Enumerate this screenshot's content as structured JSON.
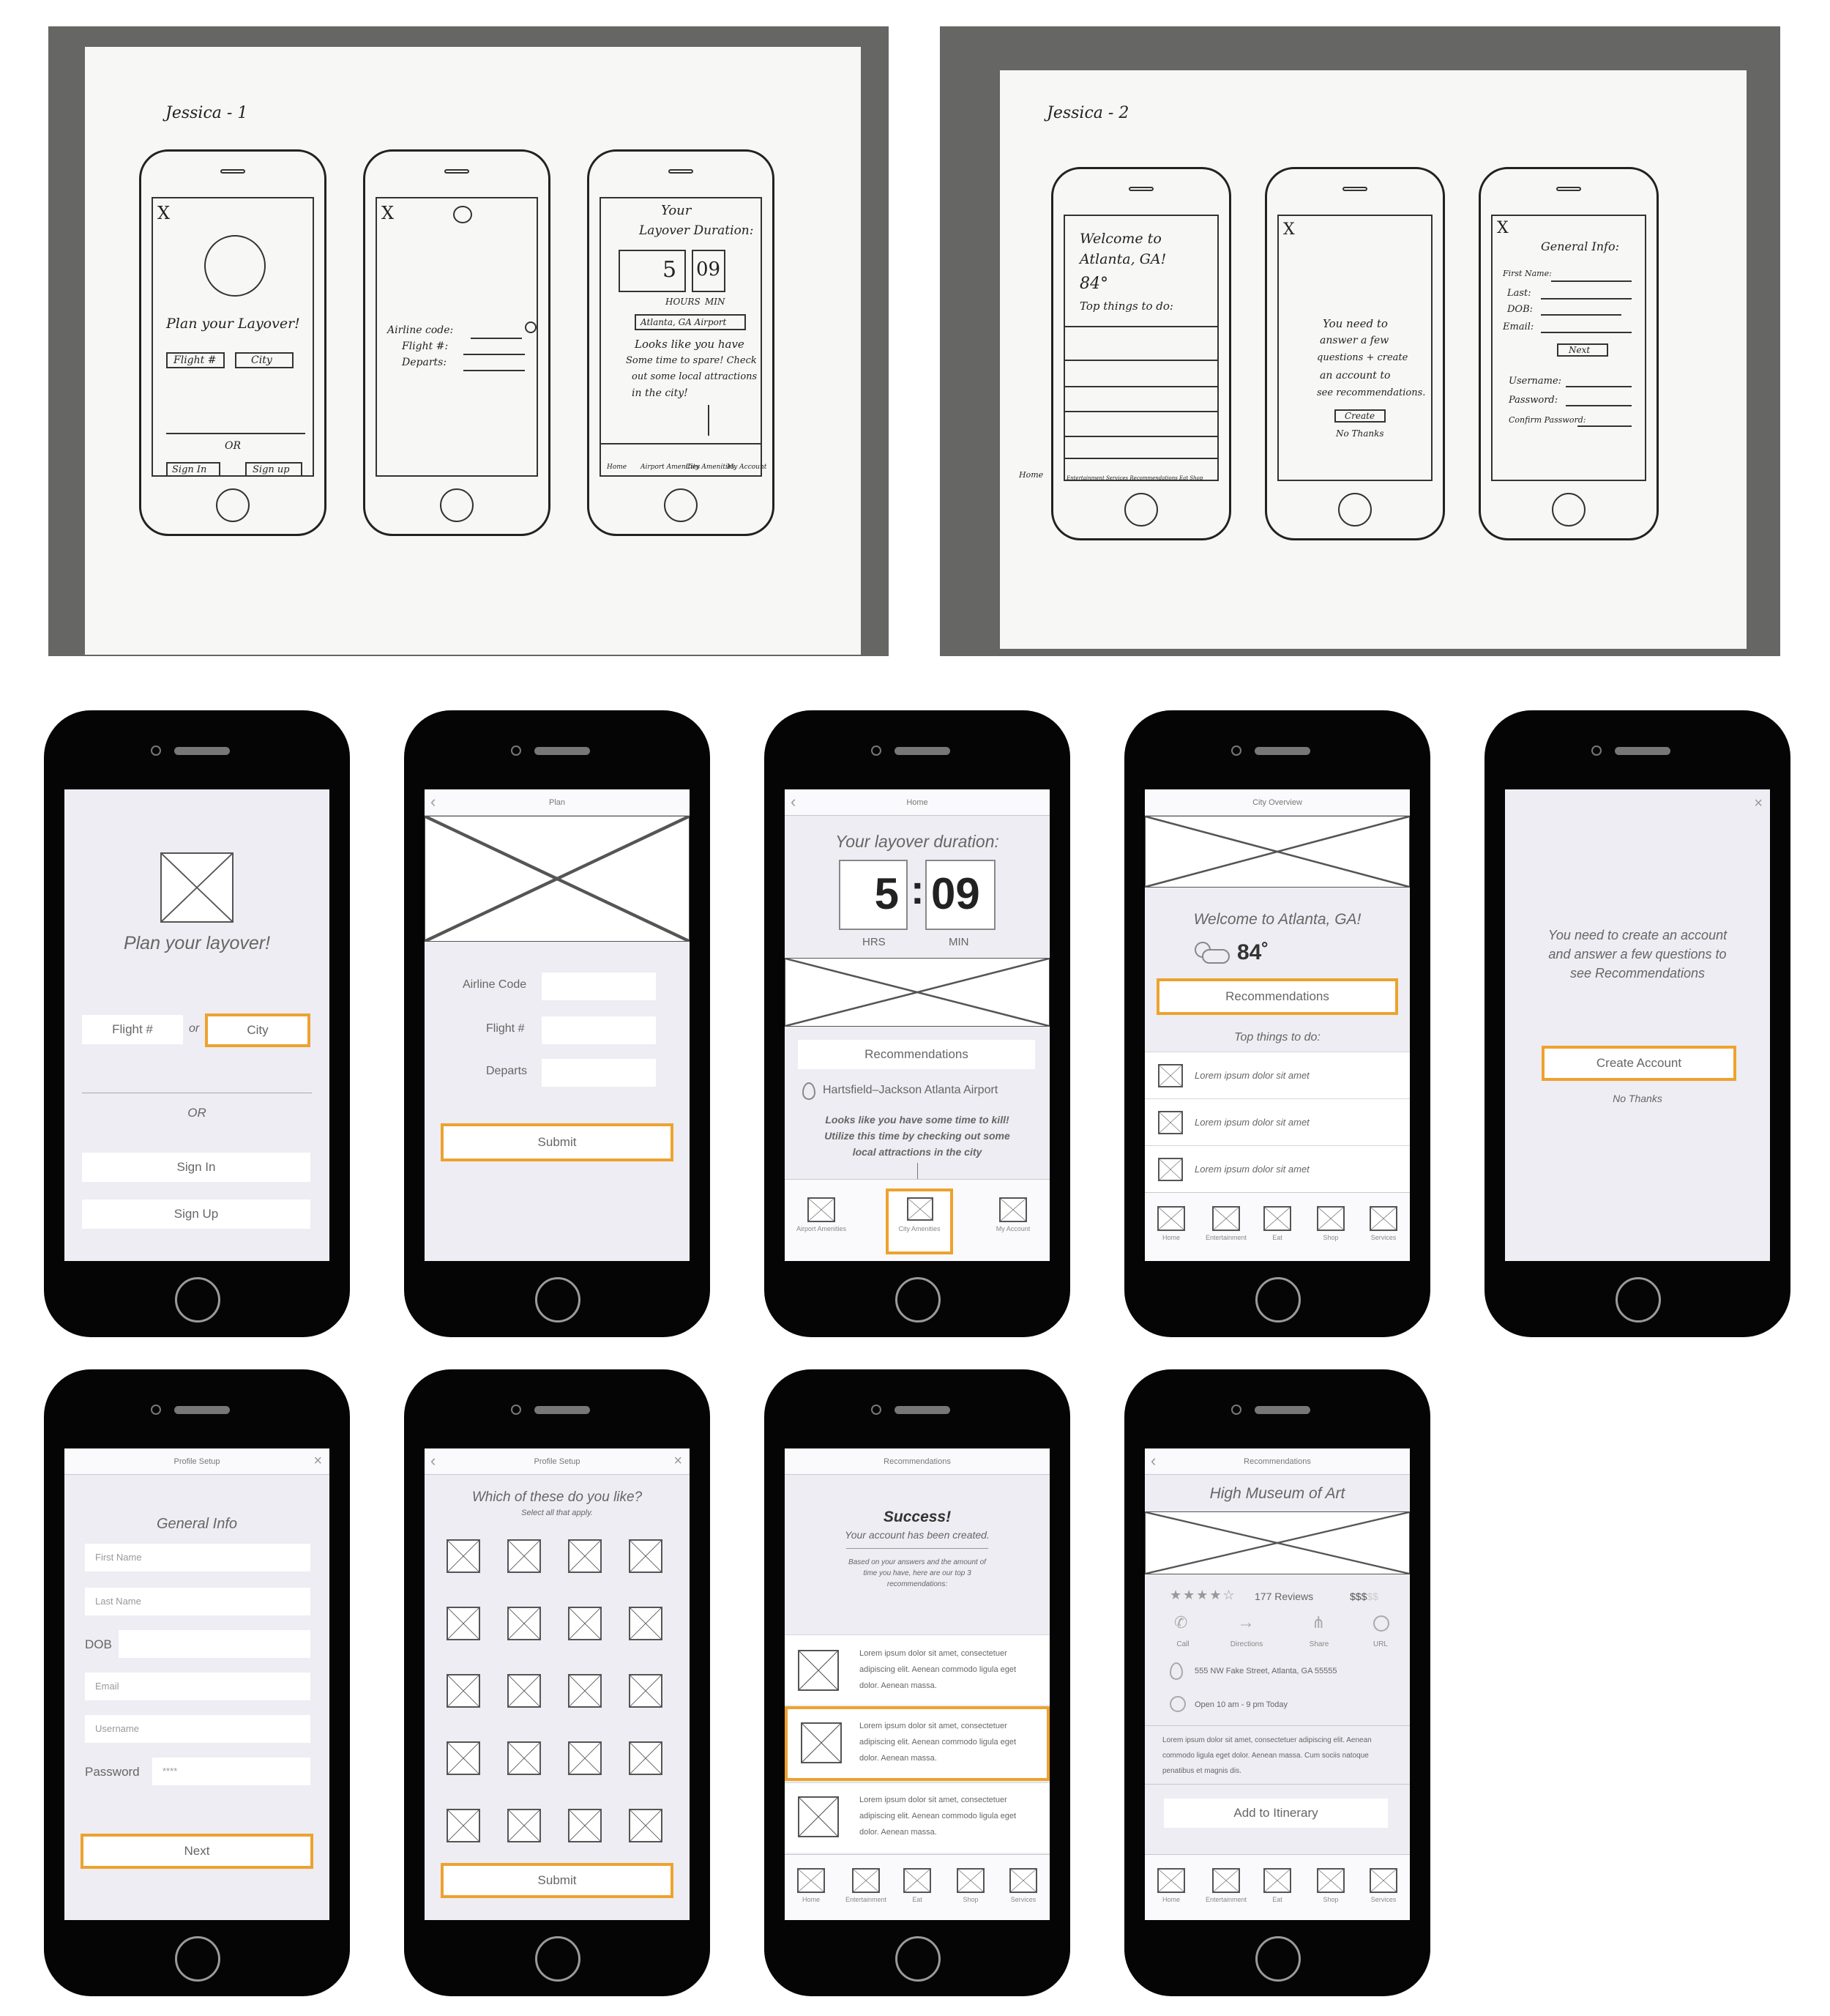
{
  "colors": {
    "accent": "#eda22e",
    "phone_body": "#050505",
    "screen_bg": "#ededf3"
  },
  "sketch1": {
    "title": "Jessica - 1",
    "p1": {
      "close": "X",
      "title": "Plan your Layover!",
      "btn_flight": "Flight #",
      "btn_city": "City",
      "or": "OR",
      "btn_signin": "Sign In",
      "btn_signup": "Sign up"
    },
    "p2": {
      "close": "X",
      "airline": "Airline code:",
      "flight": "Flight #:",
      "departs": "Departs:"
    },
    "p3": {
      "title1": "Your",
      "title2": "Layover Duration:",
      "hours": "5",
      "mins": "09",
      "hours_label": "HOURS",
      "mins_label": "MIN",
      "airport": "Atlanta, GA Airport",
      "msg1": "Looks like you have",
      "msg2": "Some time to spare! Check",
      "msg3": "out some local attractions",
      "msg4": "in the city!",
      "tabs": [
        "Home",
        "Airport Amenities",
        "City Amenities",
        "My Account"
      ]
    }
  },
  "sketch2": {
    "title": "Jessica - 2",
    "p1": {
      "welcome1": "Welcome to",
      "welcome2": "Atlanta, GA!",
      "temp": "84°",
      "top": "Top things to do:",
      "home": "Home",
      "tabs": "Entertainment Services Recommendations Eat Shop"
    },
    "p2": {
      "close": "X",
      "msg1": "You need to",
      "msg2": "answer a few",
      "msg3": "questions + create",
      "msg4": "an account to",
      "msg5": "see recommendations.",
      "create": "Create",
      "nothanks": "No Thanks"
    },
    "p3": {
      "close": "X",
      "title": "General Info:",
      "first": "First Name:",
      "last": "Last:",
      "dob": "DOB:",
      "email": "Email:",
      "next": "Next",
      "username": "Username:",
      "password": "Password:",
      "confirm": "Confirm Password:"
    }
  },
  "wf1": {
    "title": "Plan your layover!",
    "flight": "Flight #",
    "or_small": "or",
    "city": "City",
    "or": "OR",
    "signin": "Sign In",
    "signup": "Sign Up"
  },
  "wf2": {
    "header": "Plan",
    "airline": "Airline Code",
    "flight": "Flight #",
    "departs": "Departs",
    "submit": "Submit"
  },
  "wf3": {
    "header": "Home",
    "duration": "Your layover duration:",
    "hours": "5",
    "colon": ":",
    "mins": "09",
    "hrs_label": "HRS",
    "min_label": "MIN",
    "recs": "Recommendations",
    "airport": "Hartsfield–Jackson Atlanta Airport",
    "msg": "Looks like you have some time to kill! Utilize this time by checking out some local attractions in the city",
    "tabs": [
      "Airport Amenities",
      "City Amenities",
      "My Account"
    ]
  },
  "wf4": {
    "header": "City Overview",
    "welcome": "Welcome to Atlanta, GA!",
    "temp": "84˚",
    "recs": "Recommendations",
    "top": "Top things to do:",
    "items": [
      "Lorem ipsum dolor sit amet",
      "Lorem ipsum dolor sit amet",
      "Lorem ipsum dolor sit amet"
    ],
    "tabs": [
      "Home",
      "Entertainment",
      "Eat",
      "Shop",
      "Services"
    ]
  },
  "wf5": {
    "msg": "You need to create an account and answer a few questions to see Recommendations",
    "create": "Create Account",
    "nothanks": "No Thanks"
  },
  "wf6": {
    "header": "Profile Setup",
    "title": "General Info",
    "first": "First Name",
    "last": "Last Name",
    "dob": "DOB",
    "email": "Email",
    "username": "Username",
    "password": "Password",
    "password_value": "****",
    "next": "Next"
  },
  "wf7": {
    "header": "Profile Setup",
    "title": "Which of these do you like?",
    "subtitle": "Select all that apply.",
    "submit": "Submit"
  },
  "wf8": {
    "header": "Recommendations",
    "success": "Success!",
    "created": "Your account has been created.",
    "based": "Based on your answers and the amount of time you have, here are our top 3 recommendations:",
    "items": [
      "Lorem ipsum dolor sit amet, consectetuer adipiscing elit. Aenean commodo ligula eget dolor. Aenean massa.",
      "Lorem ipsum dolor sit amet, consectetuer adipiscing elit. Aenean commodo ligula eget dolor. Aenean massa.",
      "Lorem ipsum dolor sit amet, consectetuer adipiscing elit. Aenean commodo ligula eget dolor. Aenean massa."
    ],
    "tabs": [
      "Home",
      "Entertainment",
      "Eat",
      "Shop",
      "Services"
    ]
  },
  "wf9": {
    "header": "Recommendations",
    "title": "High Museum of Art",
    "reviews": "177 Reviews",
    "price": "$$$",
    "price_dim": "$$",
    "actions": [
      "Call",
      "Directions",
      "Share",
      "URL"
    ],
    "address": "555 NW Fake Street, Atlanta, GA 55555",
    "hours": "Open 10 am - 9 pm Today",
    "desc": "Lorem ipsum dolor sit amet, consectetuer adipiscing elit. Aenean commodo ligula eget dolor. Aenean massa. Cum sociis natoque penatibus et magnis dis.",
    "add": "Add to Itinerary",
    "tabs": [
      "Home",
      "Entertainment",
      "Eat",
      "Shop",
      "Services"
    ]
  }
}
